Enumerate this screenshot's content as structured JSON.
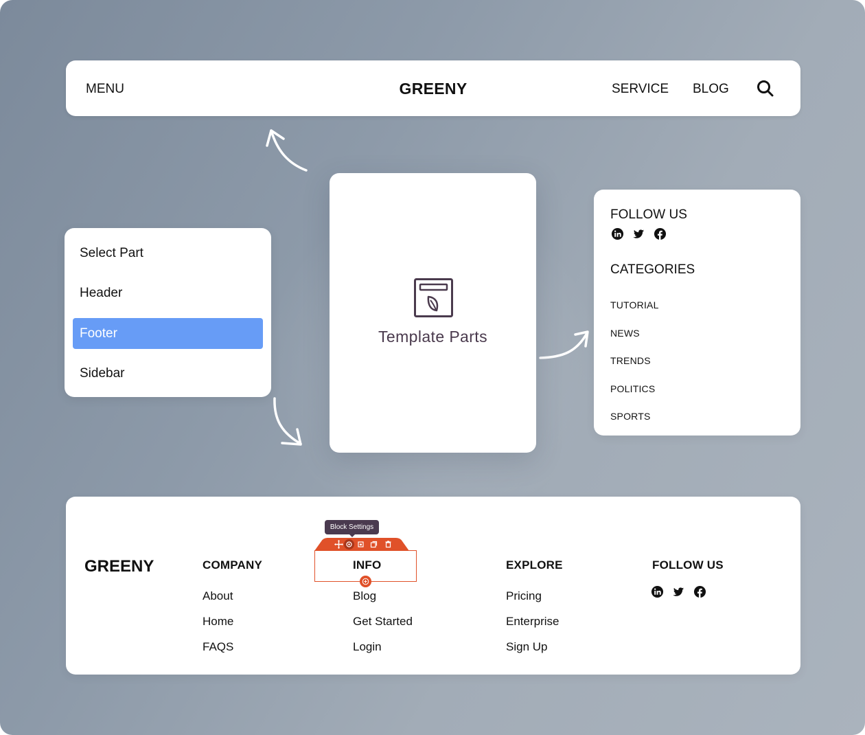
{
  "colors": {
    "accent_selected": "#679cf6",
    "template_icon": "#4a3a4d",
    "block_toolbar": "#e05129",
    "tooltip_bg": "#4a3a4f"
  },
  "header": {
    "menu_label": "MENU",
    "logo": "GREENY",
    "nav": [
      "SERVICE",
      "BLOG"
    ],
    "search_icon": "search-icon"
  },
  "select_part": {
    "options": [
      {
        "label": "Select Part",
        "selected": false
      },
      {
        "label": "Header",
        "selected": false
      },
      {
        "label": "Footer",
        "selected": true
      },
      {
        "label": "Sidebar",
        "selected": false
      }
    ]
  },
  "template_parts": {
    "icon": "template-part-icon",
    "label": "Template Parts"
  },
  "sidebar": {
    "follow_heading": "FOLLOW US",
    "social_icons": [
      "linkedin-icon",
      "twitter-icon",
      "facebook-icon"
    ],
    "categories_heading": "CATEGORIES",
    "categories": [
      "TUTORIAL",
      "NEWS",
      "TRENDS",
      "POLITICS",
      "SPORTS"
    ]
  },
  "footer": {
    "logo": "GREENY",
    "columns": [
      {
        "heading": "COMPANY",
        "links": [
          "About",
          "Home",
          "FAQS"
        ]
      },
      {
        "heading": "INFO",
        "links": [
          "Blog",
          "Get Started",
          "Login"
        ]
      },
      {
        "heading": "EXPLORE",
        "links": [
          "Pricing",
          "Enterprise",
          "Sign Up"
        ]
      },
      {
        "heading": "FOLLOW US",
        "links": []
      }
    ],
    "social_icons": [
      "linkedin-icon",
      "twitter-icon",
      "facebook-icon"
    ],
    "block_toolbar": {
      "tooltip": "Block Settings",
      "buttons": [
        "move-icon",
        "settings-icon",
        "save-icon",
        "duplicate-icon",
        "delete-icon"
      ],
      "active_button": "settings-icon"
    }
  }
}
